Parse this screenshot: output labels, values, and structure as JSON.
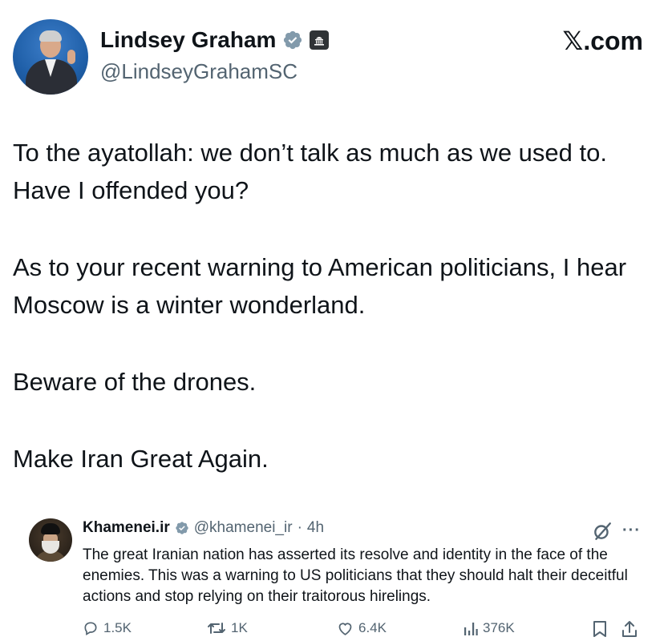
{
  "author": {
    "name": "Lindsey Graham",
    "handle": "@LindseyGrahamSC"
  },
  "watermark": "𝕏.com",
  "tweet": {
    "paragraphs": [
      "To the ayatollah: we don’t talk as much as we used to. Have I offended you?",
      "As to your recent warning to American politicians, I hear Moscow is a winter wonderland.",
      "Beware of the drones.",
      "Make Iran Great Again."
    ]
  },
  "quoted": {
    "name": "Khamenei.ir",
    "handle": "@khamenei_ir",
    "separator": "·",
    "time": "4h",
    "text": "The great Iranian nation has asserted its resolve and identity in the face of the enemies. This was a warning to US politicians that they should halt their deceitful actions and stop relying on their traitorous hirelings."
  },
  "actions": {
    "replies": "1.5K",
    "reposts": "1K",
    "likes": "6.4K",
    "views": "376K"
  },
  "icons": {
    "verified": "verified-badge-icon",
    "government": "government-building-icon",
    "grok": "grok-icon",
    "more": "more-options-icon",
    "reply": "reply-icon",
    "repost": "repost-icon",
    "like": "heart-icon",
    "views": "views-chart-icon",
    "bookmark": "bookmark-icon",
    "share": "share-icon"
  },
  "colors": {
    "text": "#0f1419",
    "secondary": "#536471",
    "verified_gray": "#829aab"
  }
}
